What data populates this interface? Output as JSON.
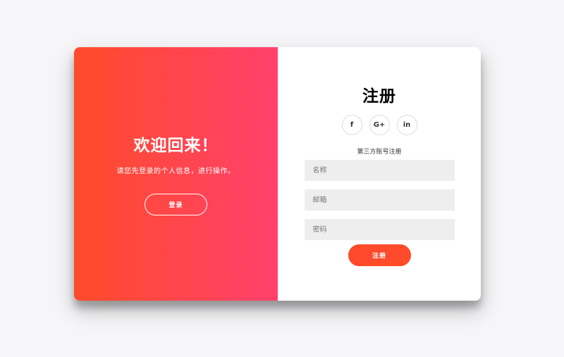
{
  "colors": {
    "gradient_start": "#ff4b2b",
    "gradient_end": "#ff416c",
    "accent": "#ff4b2b",
    "input_bg": "#eeeeee",
    "page_bg": "#f6f5f7"
  },
  "overlay": {
    "title": "欢迎回来！",
    "text": "请您先登录的个人信息，进行操作。",
    "login_button": "登录"
  },
  "signup": {
    "title": "注册",
    "social": [
      {
        "icon": "facebook-icon",
        "glyph": "f"
      },
      {
        "icon": "google-plus-icon",
        "glyph": "G+"
      },
      {
        "icon": "linkedin-icon",
        "glyph": "in"
      }
    ],
    "social_hint": "第三方账号注册",
    "fields": {
      "name_placeholder": "名称",
      "email_placeholder": "邮箱",
      "password_placeholder": "密码"
    },
    "submit_button": "注册"
  }
}
